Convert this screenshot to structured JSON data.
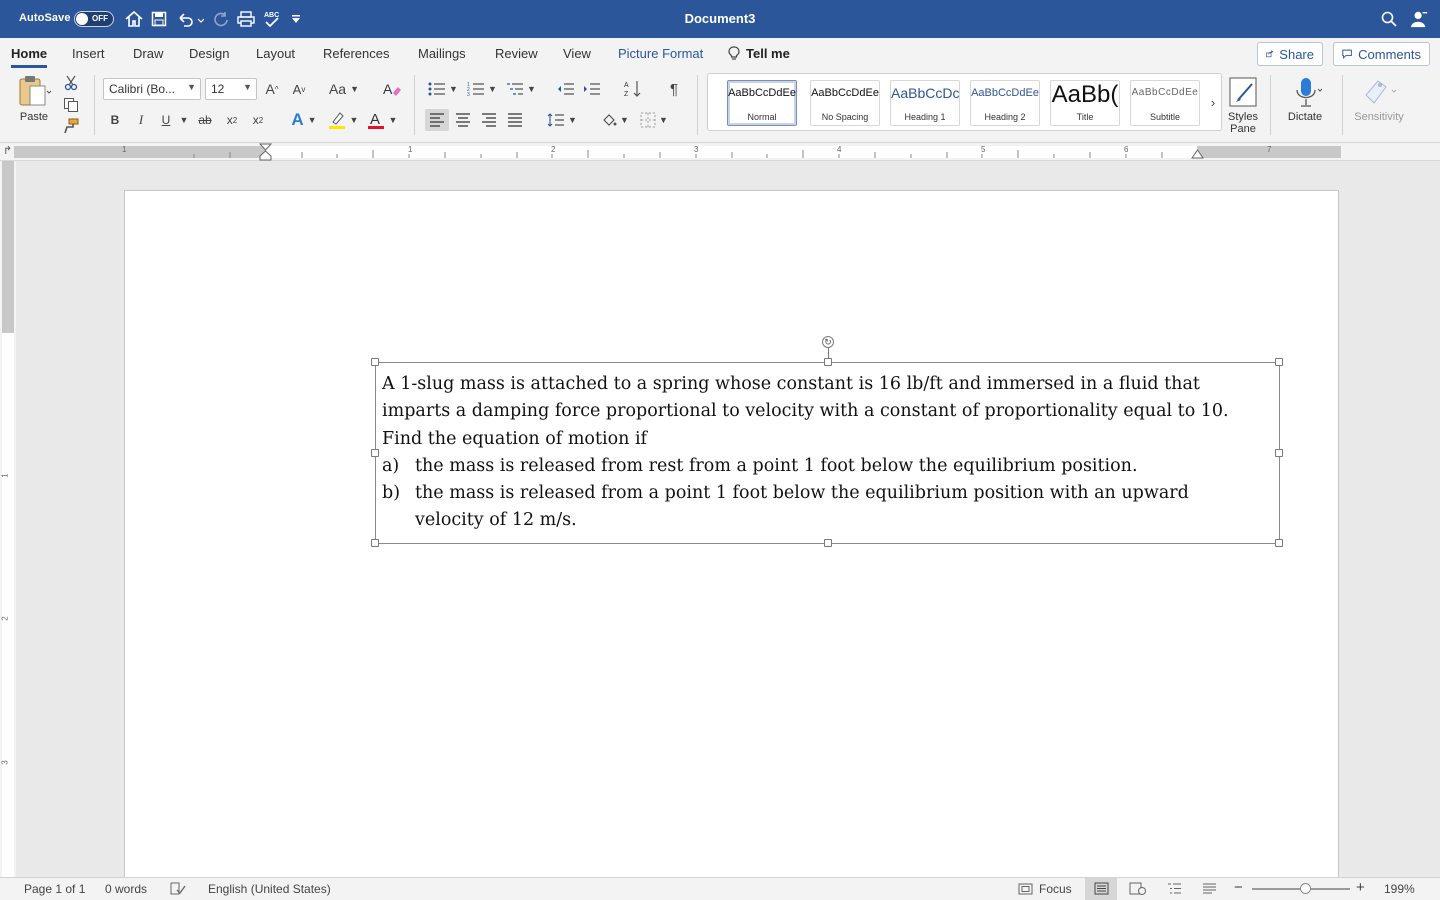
{
  "titlebar": {
    "autosave_label": "AutoSave",
    "autosave_state": "OFF",
    "document_title": "Document3",
    "icons": [
      "home-icon",
      "save-icon",
      "undo-icon",
      "redo-icon",
      "print-icon",
      "spelling-icon",
      "customize-icon",
      "search-icon",
      "account-icon"
    ]
  },
  "tabs": {
    "home": "Home",
    "insert": "Insert",
    "draw": "Draw",
    "design": "Design",
    "layout": "Layout",
    "references": "References",
    "mailings": "Mailings",
    "review": "Review",
    "view": "View",
    "picture_format": "Picture Format",
    "tell_me": "Tell me",
    "share": "Share",
    "comments": "Comments"
  },
  "ribbon": {
    "paste_label": "Paste",
    "font_name": "Calibri (Bo...",
    "font_size": "12",
    "case_label": "Aa",
    "bold": "B",
    "italic": "I",
    "underline": "U",
    "strike": "ab",
    "styles": [
      {
        "sample": "AaBbCcDdEe",
        "name": "Normal"
      },
      {
        "sample": "AaBbCcDdEe",
        "name": "No Spacing"
      },
      {
        "sample": "AaBbCcDc",
        "name": "Heading 1"
      },
      {
        "sample": "AaBbCcDdEe",
        "name": "Heading 2"
      },
      {
        "sample": "AaBb(",
        "name": "Title"
      },
      {
        "sample": "AaBbCcDdEe",
        "name": "Subtitle"
      }
    ],
    "styles_pane_line1": "Styles",
    "styles_pane_line2": "Pane",
    "dictate": "Dictate",
    "sensitivity": "Sensitivity"
  },
  "ruler": {
    "marks": [
      "1",
      "1",
      "2",
      "3",
      "4",
      "5",
      "6",
      "7"
    ],
    "vmarks": [
      "1",
      "2",
      "3"
    ]
  },
  "document": {
    "paragraph": "A 1-slug mass is attached to a spring whose constant is 16 lb/ft and immersed in a fluid that imparts a damping force proportional to velocity with a constant of proportionality equal to 10. Find the equation of motion if",
    "items": [
      {
        "marker": "a)",
        "text": "the mass is released from rest from a point 1 foot below the equilibrium position."
      },
      {
        "marker": "b)",
        "text": "the mass is released from a point 1 foot below the equilibrium position with an upward velocity of 12 m/s."
      }
    ]
  },
  "status": {
    "page": "Page 1 of 1",
    "words": "0 words",
    "language": "English (United States)",
    "focus": "Focus",
    "zoom": "199%",
    "zoom_level": 0.55
  },
  "colors": {
    "accent": "#2b579a",
    "highlight": "#ffe600",
    "font_color": "#e81123"
  }
}
